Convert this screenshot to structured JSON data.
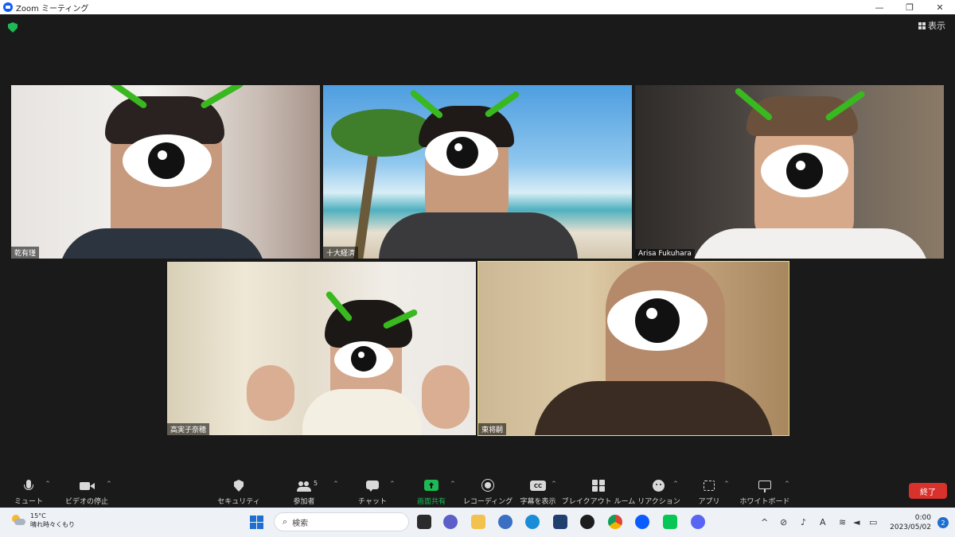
{
  "window": {
    "title": "Zoom ミーティング",
    "minimize": "—",
    "restore": "❐",
    "close": "✕"
  },
  "meeting": {
    "view_label": "表示",
    "participants": [
      {
        "name": "乾有瑾",
        "bg": "#cfc9c3"
      },
      {
        "name": "十大経済",
        "bg": "#6db6e8"
      },
      {
        "name": "Arisa Fukuhara",
        "bg": "#3a3633"
      },
      {
        "name": "高実子奈穂",
        "bg": "#e2d9c4"
      },
      {
        "name": "東将嗣",
        "bg": "#b39a76"
      }
    ]
  },
  "toolbar": {
    "items": [
      {
        "label": "ミュート",
        "icon": "microphone-icon"
      },
      {
        "label": "ビデオの停止",
        "icon": "video-camera-icon"
      },
      {
        "label": "セキュリティ",
        "icon": "shield-icon"
      },
      {
        "label": "参加者",
        "icon": "participants-icon",
        "count": "5"
      },
      {
        "label": "チャット",
        "icon": "chat-icon"
      },
      {
        "label": "画面共有",
        "icon": "share-screen-icon"
      },
      {
        "label": "レコーディング",
        "icon": "record-icon"
      },
      {
        "label": "字幕を表示",
        "icon": "captions-icon",
        "glyph": "CC"
      },
      {
        "label": "ブレイクアウト ルーム",
        "icon": "breakout-icon"
      },
      {
        "label": "リアクション",
        "icon": "reaction-icon"
      },
      {
        "label": "アプリ",
        "icon": "apps-icon"
      },
      {
        "label": "ホワイトボード",
        "icon": "whiteboard-icon"
      }
    ],
    "end_label": "終了",
    "share_color": "#1db954",
    "end_color": "#d9312b"
  },
  "taskbar": {
    "weather_temp": "15°C",
    "weather_desc": "晴れ時々くもり",
    "search_placeholder": "検索",
    "time": "0:00",
    "date": "2023/05/02",
    "notifications": "2"
  }
}
